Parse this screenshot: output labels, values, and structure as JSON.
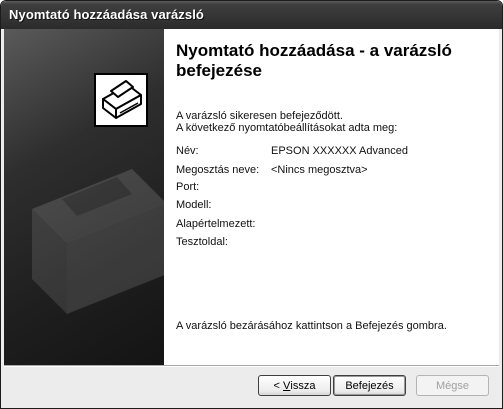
{
  "window": {
    "title": "Nyomtató hozzáadása varázsló"
  },
  "main": {
    "heading": "Nyomtató hozzáadása - a varázsló befejezése",
    "intro_line1": "A varázsló sikeresen befejeződött.",
    "intro_line2": "A következő nyomtatóbeállításokat adta meg:",
    "fields": [
      {
        "label": "Név:",
        "value": "EPSON XXXXXX Advanced"
      },
      {
        "label": "Megosztás neve:",
        "value": "<Nincs megosztva>"
      },
      {
        "label": "Port:",
        "value": ""
      },
      {
        "label": "Modell:",
        "value": ""
      },
      {
        "label": "Alapértelmezett:",
        "value": ""
      },
      {
        "label": "Tesztoldal:",
        "value": ""
      }
    ],
    "footer_text": "A varázsló bezárásához kattintson a Befejezés gombra."
  },
  "buttons": {
    "back_prefix": "< ",
    "back_hotkey": "V",
    "back_rest": "issza",
    "finish": "Befejezés",
    "cancel": "Mégse"
  },
  "icons": {
    "printer": "printer-icon"
  }
}
